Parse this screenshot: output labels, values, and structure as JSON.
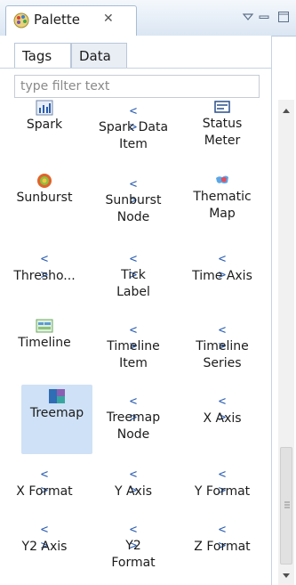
{
  "view": {
    "title": "Palette",
    "close_glyph": "✕"
  },
  "tabs": [
    {
      "label": "Tags",
      "active": true
    },
    {
      "label": "Data",
      "active": false
    }
  ],
  "filter": {
    "placeholder": "type filter text",
    "value": ""
  },
  "items": [
    {
      "label": "Spark",
      "icon": "spark-chart-icon"
    },
    {
      "label": "Spark Data Item",
      "icon": "tag-icon"
    },
    {
      "label": "Status Meter",
      "icon": "status-meter-icon"
    },
    {
      "label": "Sunburst",
      "icon": "sunburst-icon"
    },
    {
      "label": "Sunburst Node",
      "icon": "tag-icon"
    },
    {
      "label": "Thematic Map",
      "icon": "thematic-map-icon"
    },
    {
      "label": "Thresho...",
      "icon": "tag-icon"
    },
    {
      "label": "Tick Label",
      "icon": "tag-icon"
    },
    {
      "label": "Time Axis",
      "icon": "tag-icon"
    },
    {
      "label": "Timeline",
      "icon": "timeline-icon"
    },
    {
      "label": "Timeline Item",
      "icon": "tag-icon"
    },
    {
      "label": "Timeline Series",
      "icon": "tag-icon"
    },
    {
      "label": "Treemap",
      "icon": "treemap-icon",
      "selected": true
    },
    {
      "label": "Treemap Node",
      "icon": "tag-icon"
    },
    {
      "label": "X Axis",
      "icon": "tag-icon"
    },
    {
      "label": "X Format",
      "icon": "tag-icon"
    },
    {
      "label": "Y Axis",
      "icon": "tag-icon"
    },
    {
      "label": "Y Format",
      "icon": "tag-icon"
    },
    {
      "label": "Y2 Axis",
      "icon": "tag-icon"
    },
    {
      "label": "Y2 Format",
      "icon": "tag-icon"
    },
    {
      "label": "Z Format",
      "icon": "tag-icon"
    }
  ],
  "tag_glyph": "< >",
  "colors": {
    "accent": "#2a5db0",
    "selection": "#cfe1f6"
  }
}
